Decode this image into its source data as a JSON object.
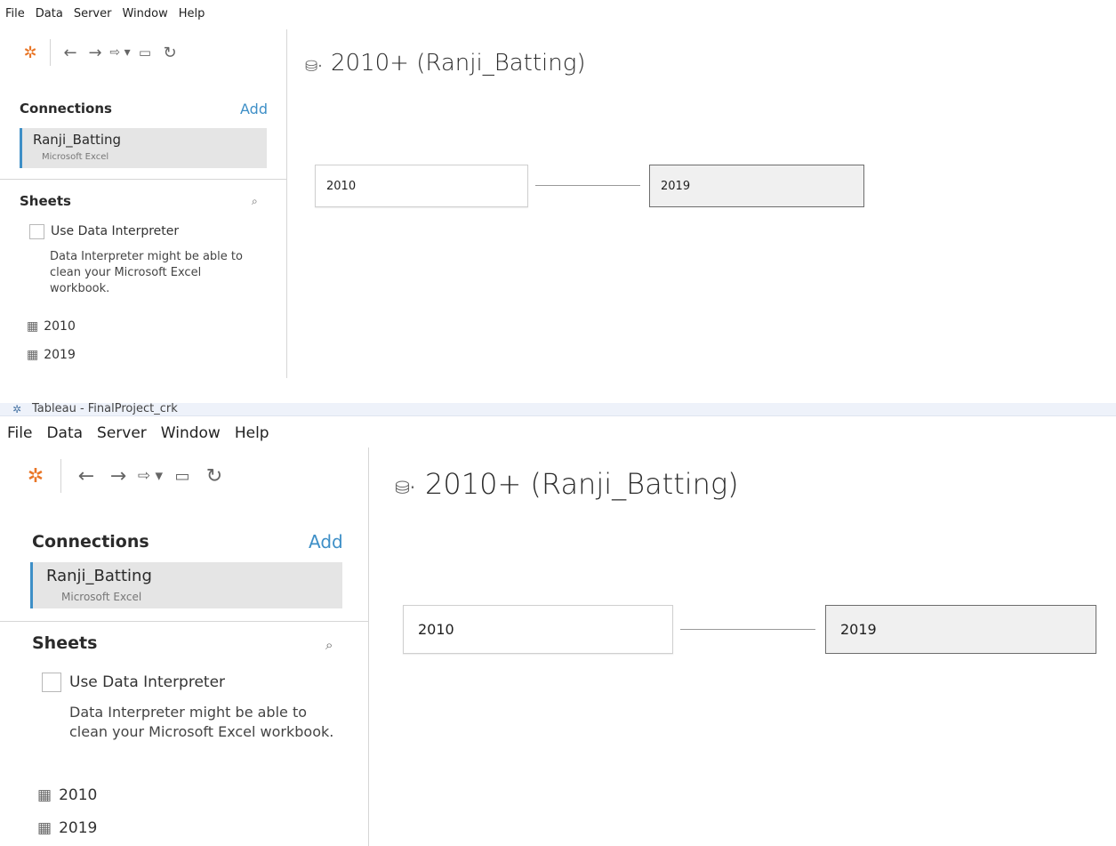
{
  "menu": [
    "File",
    "Data",
    "Server",
    "Window",
    "Help"
  ],
  "window_title": "Tableau - FinalProject_crk",
  "toolbar": {
    "logo": "tableau-logo-icon",
    "back": "back-arrow-icon",
    "forward": "forward-arrow-icon",
    "redo": "redo-dropdown-icon",
    "save": "save-icon",
    "refresh": "refresh-icon"
  },
  "connections": {
    "heading": "Connections",
    "add_label": "Add",
    "items": [
      {
        "name": "Ranji_Batting",
        "type": "Microsoft Excel"
      }
    ]
  },
  "sheets": {
    "heading": "Sheets",
    "use_interpreter_label": "Use Data Interpreter",
    "interpreter_hint": "Data Interpreter might be able to clean your Microsoft Excel workbook.",
    "items": [
      "2010",
      "2019"
    ]
  },
  "datasource": {
    "title": "2010+ (Ranji_Batting)",
    "tables": [
      "2010",
      "2019"
    ]
  },
  "colors": {
    "accent": "#3e8fc7",
    "selected_bg": "#e5e5e5",
    "tableau_orange": "#e97627"
  }
}
